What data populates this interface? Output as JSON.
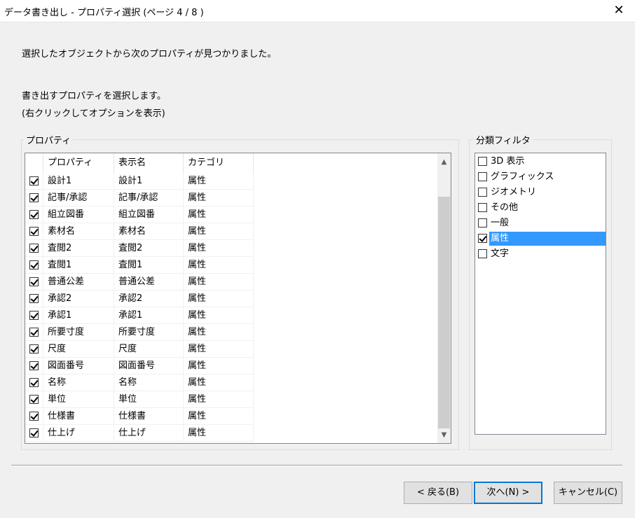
{
  "window": {
    "title": "データ書き出し - プロパティ選択 (ページ 4 / 8 )",
    "close_glyph": "✕"
  },
  "intro": {
    "found_text": "選択したオブジェクトから次のプロパティが見つかりました。",
    "select_text": "書き出すプロパティを選択します。",
    "hint_text": "(右クリックしてオプションを表示)"
  },
  "properties": {
    "group_label": "プロパティ",
    "columns": [
      "プロパティ",
      "表示名",
      "カテゴリ"
    ],
    "rows": [
      {
        "checked": true,
        "property": "設計1",
        "display": "設計1",
        "category": "属性"
      },
      {
        "checked": true,
        "property": "記事/承認",
        "display": "記事/承認",
        "category": "属性"
      },
      {
        "checked": true,
        "property": "組立図番",
        "display": "組立図番",
        "category": "属性"
      },
      {
        "checked": true,
        "property": "素材名",
        "display": "素材名",
        "category": "属性"
      },
      {
        "checked": true,
        "property": "査閲2",
        "display": "査閲2",
        "category": "属性"
      },
      {
        "checked": true,
        "property": "査閲1",
        "display": "査閲1",
        "category": "属性"
      },
      {
        "checked": true,
        "property": "普通公差",
        "display": "普通公差",
        "category": "属性"
      },
      {
        "checked": true,
        "property": "承認2",
        "display": "承認2",
        "category": "属性"
      },
      {
        "checked": true,
        "property": "承認1",
        "display": "承認1",
        "category": "属性"
      },
      {
        "checked": true,
        "property": "所要寸度",
        "display": "所要寸度",
        "category": "属性"
      },
      {
        "checked": true,
        "property": "尺度",
        "display": "尺度",
        "category": "属性"
      },
      {
        "checked": true,
        "property": "図面番号",
        "display": "図面番号",
        "category": "属性"
      },
      {
        "checked": true,
        "property": "名称",
        "display": "名称",
        "category": "属性"
      },
      {
        "checked": true,
        "property": "単位",
        "display": "単位",
        "category": "属性"
      },
      {
        "checked": true,
        "property": "仕様書",
        "display": "仕様書",
        "category": "属性"
      },
      {
        "checked": true,
        "property": "仕上げ",
        "display": "仕上げ",
        "category": "属性"
      }
    ],
    "scroll_up_glyph": "▲",
    "scroll_down_glyph": "▼"
  },
  "filter": {
    "group_label": "分類フィルタ",
    "items": [
      {
        "label": "3D 表示",
        "checked": false,
        "selected": false
      },
      {
        "label": "グラフィックス",
        "checked": false,
        "selected": false
      },
      {
        "label": "ジオメトリ",
        "checked": false,
        "selected": false
      },
      {
        "label": "その他",
        "checked": false,
        "selected": false
      },
      {
        "label": "一般",
        "checked": false,
        "selected": false
      },
      {
        "label": "属性",
        "checked": true,
        "selected": true
      },
      {
        "label": "文字",
        "checked": false,
        "selected": false
      }
    ]
  },
  "buttons": {
    "back": "< 戻る(B)",
    "next": "次へ(N) >",
    "cancel": "キャンセル(C)"
  },
  "colors": {
    "selection": "#3399ff",
    "default_button_border": "#0078d7"
  }
}
